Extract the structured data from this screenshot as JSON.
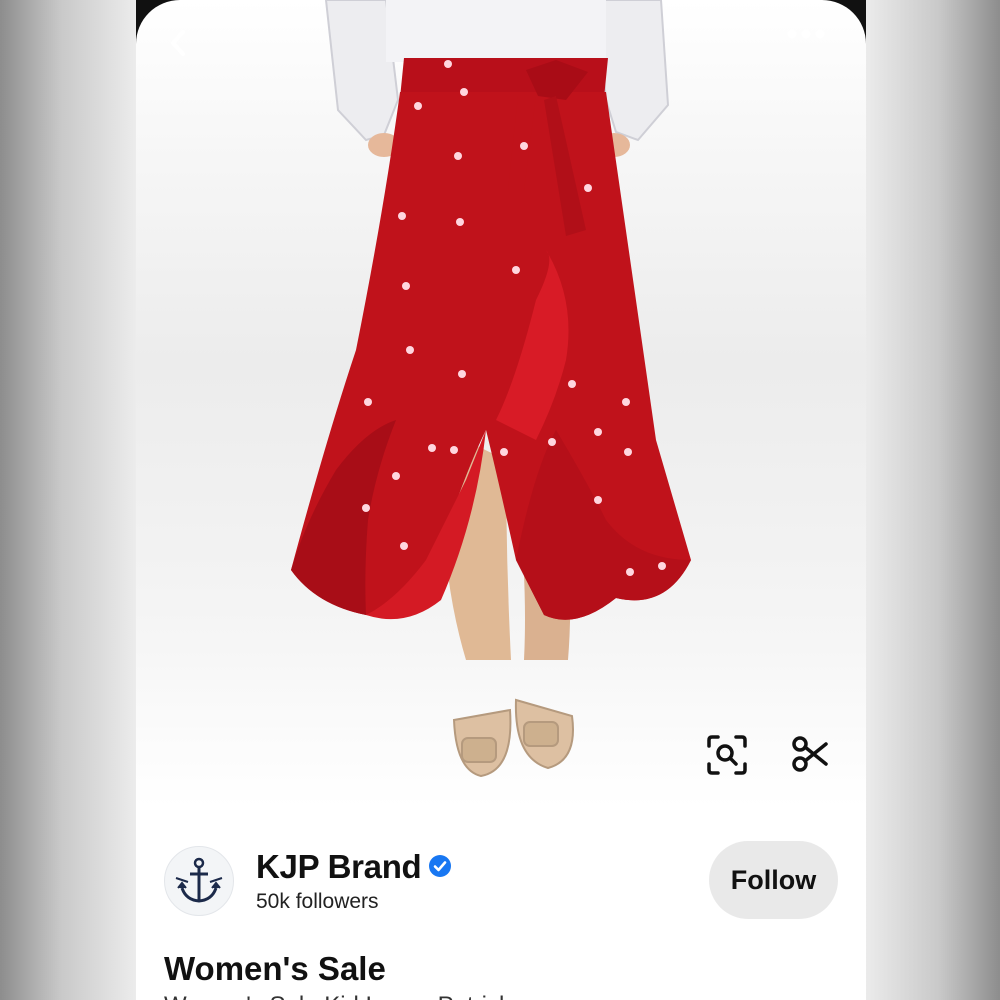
{
  "header": {
    "back_icon": "chevron-left-icon",
    "more_icon": "ellipsis-icon"
  },
  "pin": {
    "image_alt": "red-ruffled-wrap-skirt-photo",
    "product_colors": {
      "skirt": "#c0121b",
      "hearts": "#ffd6df",
      "shoes": "#ddc0a2"
    },
    "actions": {
      "lens_icon": "visual-search-icon",
      "cutout_icon": "scissors-icon"
    }
  },
  "creator": {
    "name": "KJP Brand",
    "followers": "50k followers",
    "verified_color": "#1877f2",
    "avatar_icon": "anchor-icon",
    "follow_label": "Follow"
  },
  "details": {
    "title": "Women's Sale",
    "subtitle": "Women's Sale Kid Lenny Patrick"
  },
  "theme": {
    "button_bg": "#e9e9e9",
    "text": "#111111"
  }
}
